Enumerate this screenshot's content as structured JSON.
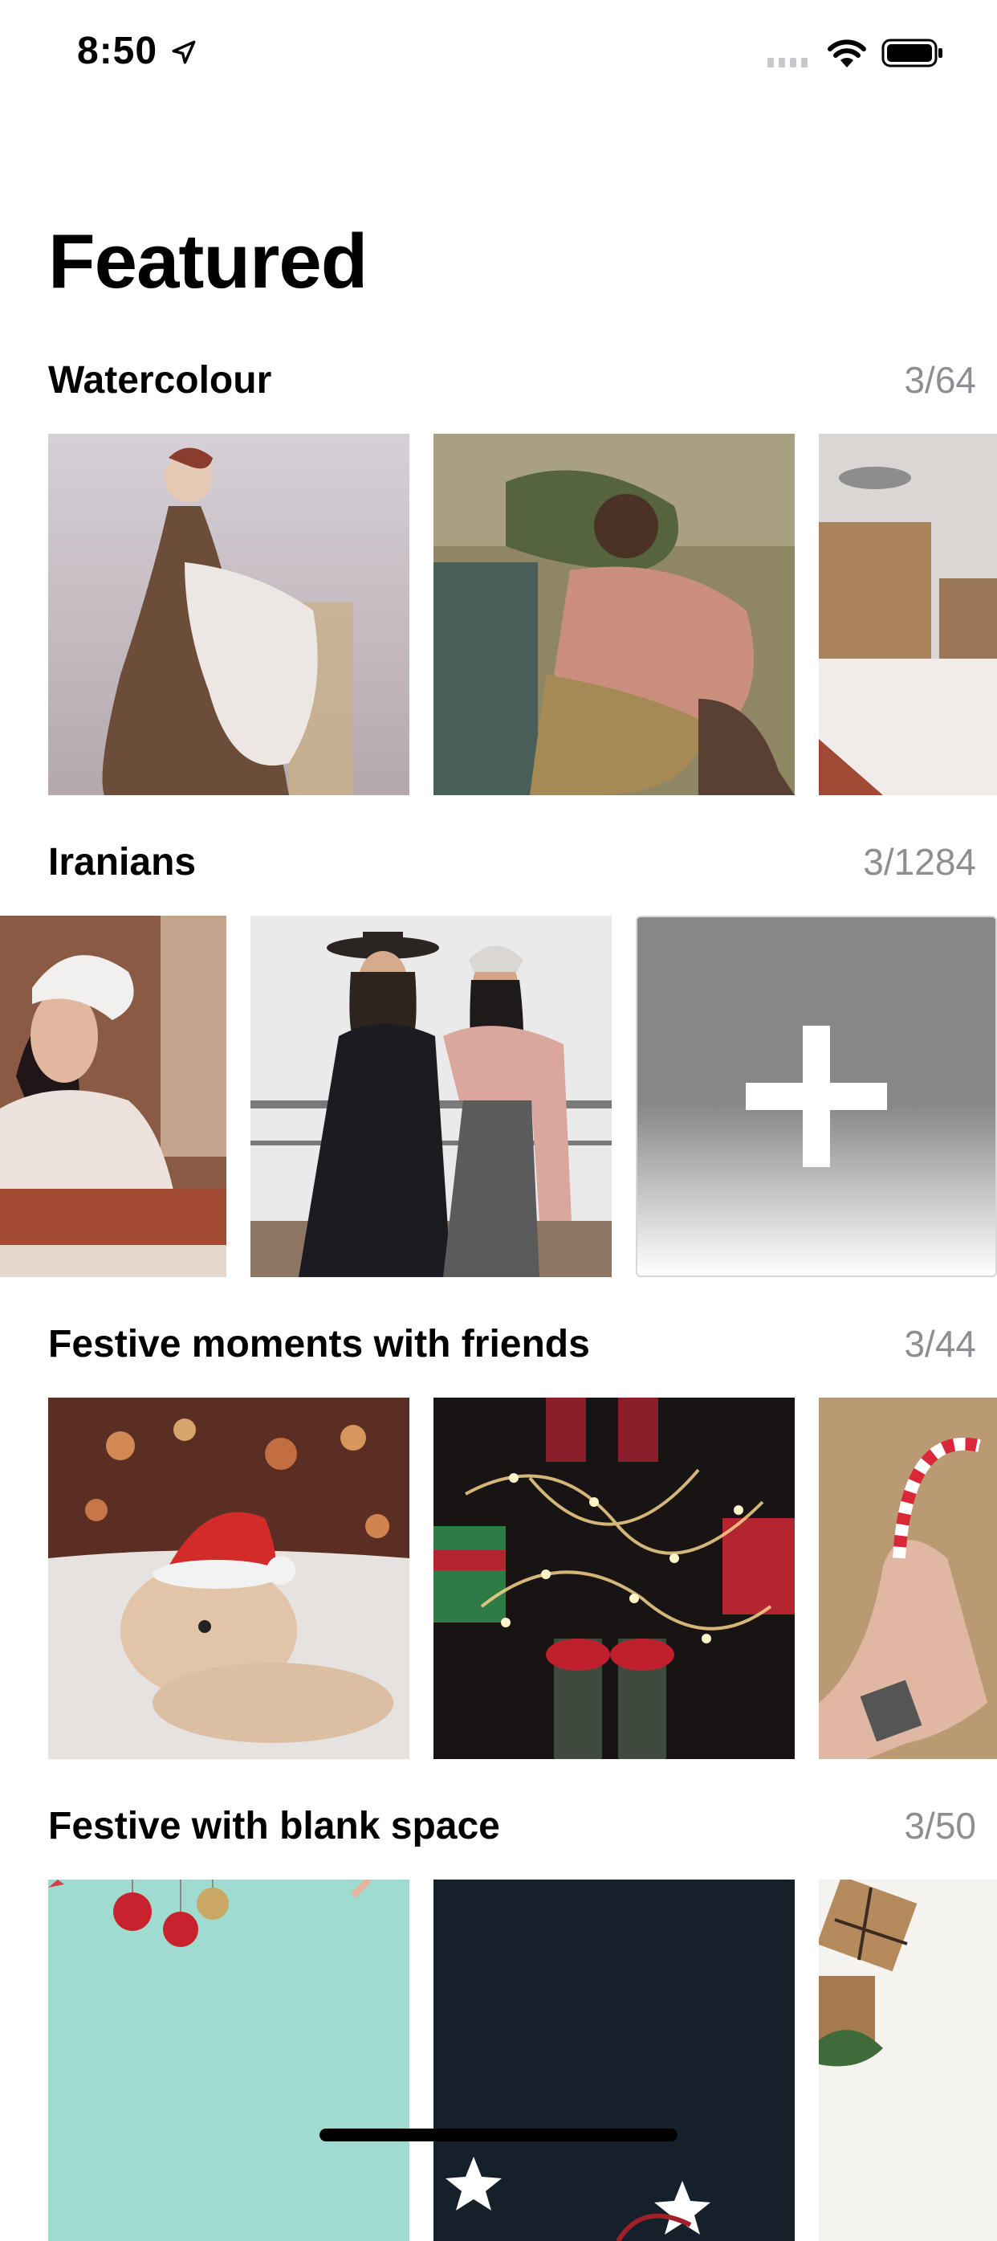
{
  "status_bar": {
    "time": "8:50"
  },
  "page": {
    "title": "Featured"
  },
  "sections": [
    {
      "title": "Watercolour",
      "count": "3/64",
      "items": [
        {
          "name": "watercolour-woman-with-child"
        },
        {
          "name": "watercolour-grieving-woman"
        },
        {
          "name": "watercolour-snowy-rooftops"
        }
      ]
    },
    {
      "title": "Iranians",
      "count": "3/1284",
      "items": [
        {
          "name": "woman-white-beanie"
        },
        {
          "name": "two-women-coats"
        }
      ],
      "add_tile": {
        "icon": "plus-icon"
      }
    },
    {
      "title": "Festive moments with friends",
      "count": "3/44",
      "items": [
        {
          "name": "puppy-santa-hat"
        },
        {
          "name": "fairy-lights-socks"
        },
        {
          "name": "candy-cane-hand"
        }
      ]
    },
    {
      "title": "Festive with blank space",
      "count": "3/50",
      "items": [
        {
          "name": "teal-ornaments"
        },
        {
          "name": "dark-stars"
        },
        {
          "name": "gift-boxes"
        }
      ]
    }
  ],
  "colors": {
    "count_gray": "#8e8e93",
    "add_tile_gray": "#878787"
  }
}
